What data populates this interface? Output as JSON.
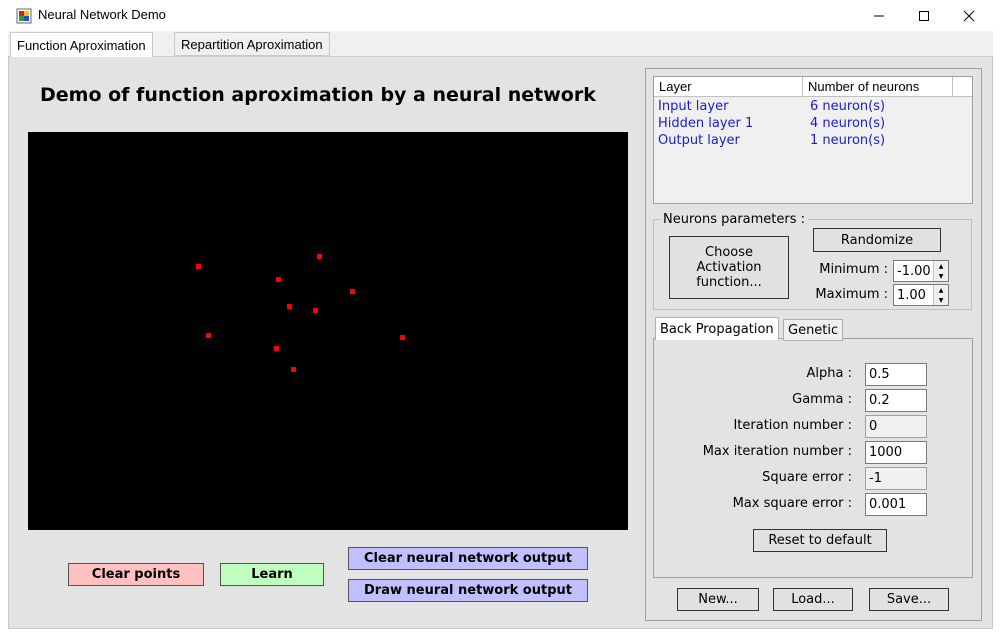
{
  "window": {
    "title": "Neural Network Demo",
    "minimize": "—",
    "maximize": "☐",
    "close": "✕"
  },
  "tabs": [
    {
      "label": "Function Aproximation"
    },
    {
      "label": "Repartition Aproximation"
    }
  ],
  "main": {
    "title": "Demo of function aproximation by a neural network",
    "buttons": {
      "clear_points": "Clear points",
      "learn": "Learn",
      "clear_nn": "Clear neural network output",
      "draw_nn": "Draw neural network output"
    }
  },
  "layers": {
    "columns": [
      "Layer",
      "Number of neurons"
    ],
    "rows": [
      {
        "layer": "Input layer",
        "neurons": "6 neuron(s)"
      },
      {
        "layer": "Hidden layer 1",
        "neurons": "4 neuron(s)"
      },
      {
        "layer": "Output layer",
        "neurons": "1 neuron(s)"
      }
    ]
  },
  "neurons_params": {
    "legend": "Neurons parameters :",
    "activation_button": "Choose Activation function...",
    "randomize_button": "Randomize",
    "minimum_label": "Minimum :",
    "minimum_value": "-1.00",
    "maximum_label": "Maximum :",
    "maximum_value": "1.00"
  },
  "training_tabs": [
    {
      "label": "Back Propagation"
    },
    {
      "label": "Genetic"
    }
  ],
  "backprop": {
    "alpha_label": "Alpha :",
    "alpha_value": "0.5",
    "gamma_label": "Gamma :",
    "gamma_value": "0.2",
    "iter_label": "Iteration number :",
    "iter_value": "0",
    "max_iter_label": "Max iteration number :",
    "max_iter_value": "1000",
    "sq_error_label": "Square error :",
    "sq_error_value": "-1",
    "max_sq_error_label": "Max square error :",
    "max_sq_error_value": "0.001",
    "reset_button": "Reset to default"
  },
  "file_buttons": {
    "new": "New...",
    "load": "Load...",
    "save": "Save..."
  },
  "colors": {
    "point": "#ff0000",
    "canvas": "#000000",
    "clear_points_bg": "#ffc0c0",
    "learn_bg": "#c0ffc0",
    "nn_buttons_bg": "#c0c0ff",
    "list_text": "#1a1adc"
  }
}
